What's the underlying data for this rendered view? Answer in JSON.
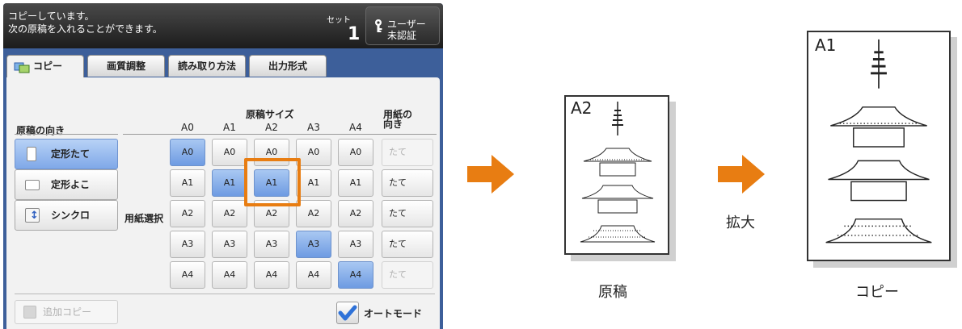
{
  "header": {
    "message_line1": "コピーしています。",
    "message_line2": "次の原稿を入れることができます。",
    "set_label": "セット",
    "set_count": "1",
    "user_line1": "ユーザー",
    "user_line2": "未認証",
    "user_icon": "user-key-icon"
  },
  "tabs": [
    {
      "label": "コピー",
      "active": true,
      "icon": "copy-icon"
    },
    {
      "label": "画質調整",
      "active": false
    },
    {
      "label": "読み取り方法",
      "active": false
    },
    {
      "label": "出力形式",
      "active": false
    }
  ],
  "panel": {
    "original_orientation_title": "原稿の向き",
    "original_size_title": "原稿サイズ",
    "paper_orientation_title_line1": "用紙の",
    "paper_orientation_title_line2": "向き",
    "paper_select_label": "用紙選択",
    "columns": [
      "A0",
      "A1",
      "A2",
      "A3",
      "A4"
    ],
    "orientation_buttons": [
      {
        "label": "定形たて",
        "selected": true,
        "icon": "portrait-page-icon"
      },
      {
        "label": "定形よこ",
        "selected": false,
        "icon": "landscape-page-icon"
      },
      {
        "label": "シンクロ",
        "selected": false,
        "icon": "sync-icon"
      }
    ],
    "rows": [
      {
        "paper": "A0",
        "cells": [
          "A0",
          "A0",
          "A0",
          "A0",
          "A0"
        ],
        "on": [
          0
        ],
        "paper_orientation": "たて",
        "paper_orientation_disabled": true
      },
      {
        "paper": "A1",
        "cells": [
          "A1",
          "A1",
          "A1",
          "A1",
          "A1"
        ],
        "on": [
          1,
          2
        ],
        "paper_orientation": "たて",
        "paper_orientation_disabled": false
      },
      {
        "paper": "A2",
        "cells": [
          "A2",
          "A2",
          "A2",
          "A2",
          "A2"
        ],
        "on": [],
        "paper_orientation": "たて",
        "paper_orientation_disabled": false
      },
      {
        "paper": "A3",
        "cells": [
          "A3",
          "A3",
          "A3",
          "A3",
          "A3"
        ],
        "on": [
          3
        ],
        "paper_orientation": "たて",
        "paper_orientation_disabled": false
      },
      {
        "paper": "A4",
        "cells": [
          "A4",
          "A4",
          "A4",
          "A4",
          "A4"
        ],
        "on": [
          4
        ],
        "paper_orientation": "たて",
        "paper_orientation_disabled": true
      }
    ],
    "highlighted_cell": {
      "original": "A2",
      "paper": "A1"
    },
    "add_copy_label": "追加コピー",
    "add_copy_disabled": true,
    "auto_mode_label": "オートモード",
    "auto_mode_checked": true
  },
  "illustration": {
    "original_size": "A2",
    "copy_size": "A1",
    "action_label": "拡大",
    "original_caption": "原稿",
    "copy_caption": "コピー",
    "arrow_color": "#e87d12",
    "highlight_color": "#e87d12"
  }
}
